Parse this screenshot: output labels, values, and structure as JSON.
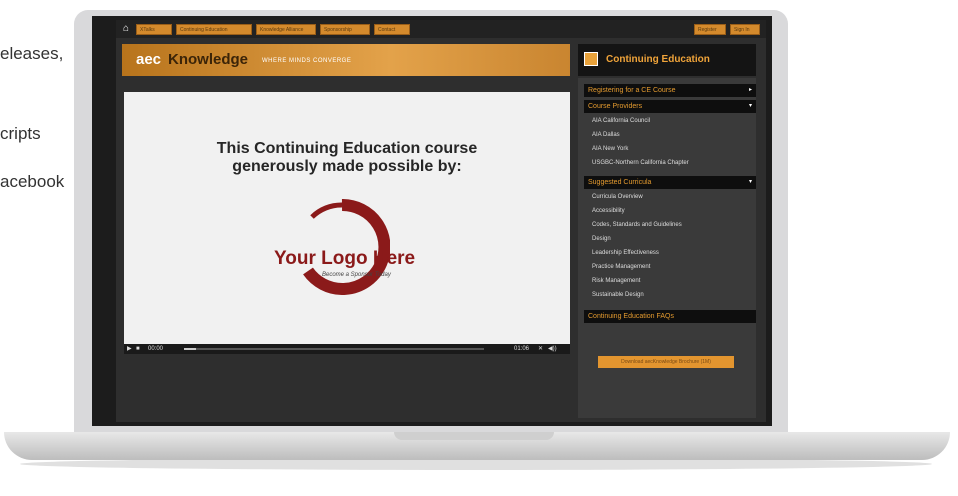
{
  "background_text": [
    "eleases,",
    "cripts",
    "acebook"
  ],
  "nav": {
    "items": [
      "XTalks",
      "Continuing Education",
      "Knowledge Alliance",
      "Sponsorship",
      "Contact"
    ],
    "right": [
      "Register",
      "Sign In"
    ]
  },
  "header": {
    "logo_aec": "aec",
    "logo_knowledge": "Knowledge",
    "tagline": "WHERE MINDS CONVERGE"
  },
  "video": {
    "line1": "This Continuing Education course",
    "line2": "generously made possible by:",
    "logo_text": "Your Logo Here",
    "sponsor_text": "Become a Sponsor Today",
    "time_current": "00:00",
    "time_total": "01:06",
    "progress": 0.04
  },
  "panel": {
    "title": "Continuing Education",
    "sections": [
      {
        "label": "Registering for a CE Course",
        "chevron": "▸"
      },
      {
        "label": "Course Providers",
        "chevron": "▾",
        "items": [
          "AIA California Council",
          "AIA Dallas",
          "AIA New York",
          "USGBC-Northern California Chapter"
        ]
      },
      {
        "label": "Suggested Curricula",
        "chevron": "▾",
        "items": [
          "Curricula Overview",
          "Accessibility",
          "Codes, Standards and Guidelines",
          "Design",
          "Leadership Effectiveness",
          "Practice Management",
          "Risk Management",
          "Sustainable Design"
        ]
      },
      {
        "label": "Continuing Education FAQs"
      }
    ],
    "download_button": "Download aecKnowledge Brochure (1M)"
  },
  "colors": {
    "accent": "#e3952f",
    "brand_dark": "#1c1c1c",
    "logo_red": "#8b1a1a"
  }
}
